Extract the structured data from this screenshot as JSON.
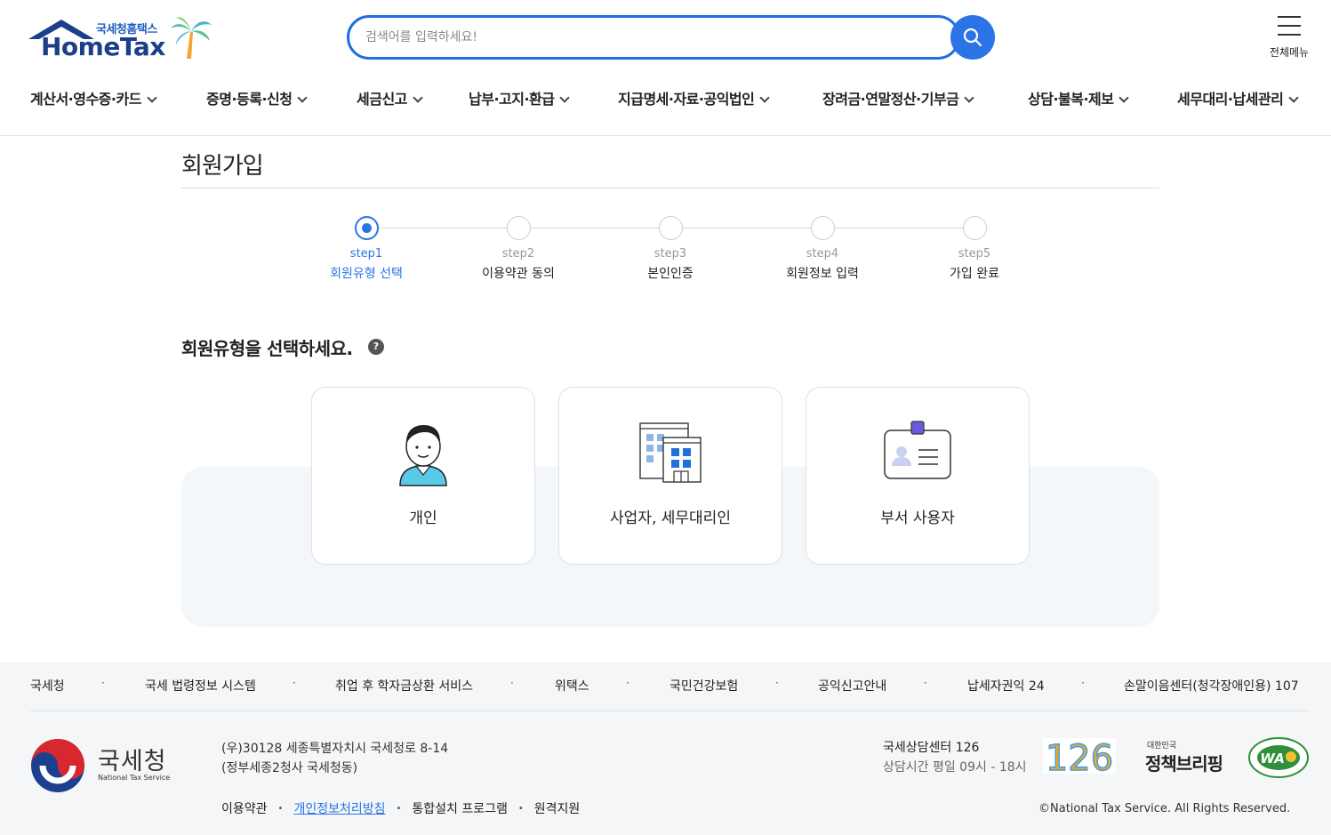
{
  "header": {
    "logo_small": "국세청홈택스",
    "logo_big": "HomeTax",
    "search_placeholder": "검색어를 입력하세요!",
    "all_menu_label": "전체메뉴"
  },
  "gnb": [
    "계산서·영수증·카드",
    "증명·등록·신청",
    "세금신고",
    "납부·고지·환급",
    "지급명세·자료·공익법인",
    "장려금·연말정산·기부금",
    "상담·불복·제보",
    "세무대리·납세관리"
  ],
  "page_title": "회원가입",
  "steps": [
    {
      "num": "step1",
      "name": "회원유형 선택"
    },
    {
      "num": "step2",
      "name": "이용약관 동의"
    },
    {
      "num": "step3",
      "name": "본인인증"
    },
    {
      "num": "step4",
      "name": "회원정보 입력"
    },
    {
      "num": "step5",
      "name": "가입 완료"
    }
  ],
  "active_step": 1,
  "section_title": "회원유형을 선택하세요.",
  "help_glyph": "?",
  "cards": [
    {
      "label": "개인",
      "icon": "person-icon"
    },
    {
      "label": "사업자, 세무대리인",
      "icon": "building-icon"
    },
    {
      "label": "부서 사용자",
      "icon": "id-card-icon"
    }
  ],
  "footer": {
    "links": [
      "국세청",
      "국세 법령정보 시스템",
      "취업 후 학자금상환 서비스",
      "위택스",
      "국민건강보험",
      "공익신고안내",
      "납세자권익 24",
      "손말이음센터(청각장애인용) 107"
    ],
    "nts_ko": "국세청",
    "nts_en": "National Tax Service",
    "address_line1": "(우)30128 세종특별자치시 국세청로 8-14",
    "address_line2": "(정부세종2청사 국세청동)",
    "bottom_links": [
      "이용약관",
      "개인정보처리방침",
      "통합설치 프로그램",
      "원격지원"
    ],
    "center_title": "국세상담센터 126",
    "center_hours": "상담시간 평일 09시 - 18시",
    "badge_126": "126",
    "policy_small": "대한민국",
    "policy_big": "정책브리핑",
    "wa_mark": "WA",
    "copyright": "©National Tax Service. All Rights Reserved."
  },
  "colors": {
    "primary": "#2a74e6",
    "logo_navy": "#1c3f8c",
    "footer_bg": "#f4f6f8"
  }
}
